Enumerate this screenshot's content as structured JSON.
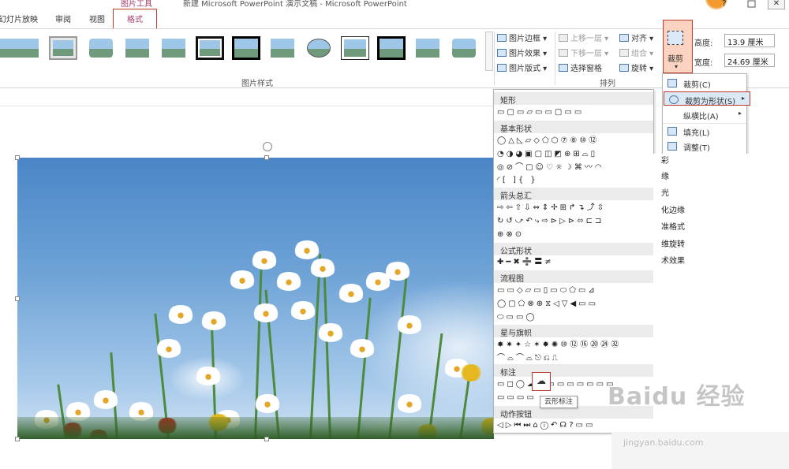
{
  "window": {
    "title": "新建 Microsoft PowerPoint 演示文稿 - Microsoft PowerPoint",
    "context_tab": "图片工具",
    "close": "✕",
    "minimize_glyph": "?"
  },
  "tabs": [
    {
      "label": "幻灯片放映"
    },
    {
      "label": "审阅"
    },
    {
      "label": "视图"
    },
    {
      "label": "格式"
    }
  ],
  "ribbon": {
    "picture_styles_label": "图片样式",
    "arrange_label": "排列",
    "picture_border": "图片边框",
    "picture_effects": "图片效果",
    "picture_layout": "图片版式",
    "bring_forward": "上移一层",
    "send_backward": "下移一层",
    "selection_pane": "选择窗格",
    "align": "对齐",
    "group": "组合",
    "rotate": "旋转",
    "crop": "裁剪",
    "height_label": "高度:",
    "height_value": "13.9 厘米",
    "width_label": "宽度:",
    "width_value": "24.69 厘米"
  },
  "crop_menu": {
    "items": [
      {
        "label": "裁剪(C)",
        "icon": "crop-icon"
      },
      {
        "label": "裁剪为形状(S)",
        "icon": "shape-icon",
        "submenu": true
      },
      {
        "label": "纵横比(A)",
        "icon": "",
        "submenu": true
      },
      {
        "label": "填充(L)",
        "icon": "fill-icon"
      },
      {
        "label": "调整(T)",
        "icon": "fit-icon"
      }
    ]
  },
  "shape_gallery": {
    "categories": [
      {
        "name": "矩形",
        "rows": [
          "▭▢▭▱▭▭▢▭▭"
        ]
      },
      {
        "name": "基本形状",
        "rows": [
          "◯△◺▱◇⬠⬡⑦⑧⑩⑫",
          "◔◑◕▣▢◫◩⊕⊞⌓▯",
          "◎⊘⌒▢☺♡☼☽⌘〰◠",
          "◜[ ]{ }"
        ]
      },
      {
        "name": "箭头总汇",
        "rows": [
          "⇨⇦⇧⇩⇔⇕✢⊞↱↴⤴⇳",
          "↻↺⤻↶⤷⇨⊳▷⊳⬄⊏⊐",
          "⊕⊗⊙"
        ]
      },
      {
        "name": "公式形状",
        "rows": [
          "✚━✖➗〓≠"
        ]
      },
      {
        "name": "流程图",
        "rows": [
          "▭▭◇▱▭▯▭⬭⬠▭⊿",
          "◯▢⬠⊗⊕⧖◁▽◀▭▭",
          "⬭▭▭◯"
        ]
      },
      {
        "name": "星与旗帜",
        "rows": [
          "✸✷✦☆✶✹✺⑩⑫⑯⑳㉔㉜",
          "⌒⌓⌒⌓⎋⎌⎍"
        ]
      },
      {
        "name": "标注",
        "rows": [
          "▭◻◯☁▭▭▭▭▭▭▭▭",
          "▭▭▭▭"
        ]
      },
      {
        "name": "动作按钮",
        "rows": [
          "◁▷⏮⏭⌂ⓘ↶☊?▭▭"
        ]
      }
    ],
    "hover_tooltip": "云形标注"
  },
  "format_pane": {
    "items": [
      "彩",
      "缘",
      "光",
      "化边缘",
      "准格式",
      "维旋转",
      "术效果"
    ]
  },
  "watermark": {
    "brand": "Baidu 经验",
    "url": "jingyan.baidu.com"
  },
  "colors": {
    "accent_red": "#c0392b",
    "format_tab": "#a43b6a",
    "crop_highlight": "#fbd3c0",
    "menu_highlight": "#dbe9f7"
  }
}
